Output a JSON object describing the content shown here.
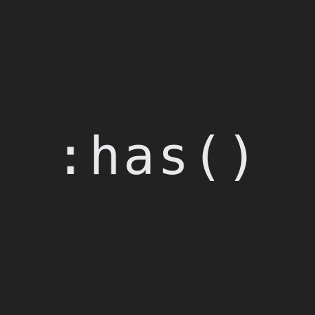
{
  "selector_text": ":has()",
  "colors": {
    "background": "#222222",
    "text": "#e8e9ec"
  }
}
